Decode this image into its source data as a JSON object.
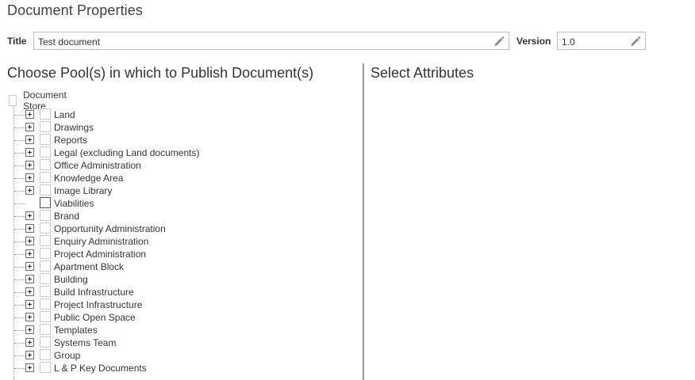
{
  "dialog": {
    "title": "Document Properties"
  },
  "fields": {
    "title_label": "Title",
    "title_value": "Test document",
    "version_label": "Version",
    "version_value": "1.0"
  },
  "pools": {
    "heading": "Choose Pool(s) in which to Publish Document(s)",
    "root_label": "Document Store",
    "items": [
      {
        "label": "Land",
        "expandable": true
      },
      {
        "label": "Drawings",
        "expandable": true
      },
      {
        "label": "Reports",
        "expandable": true
      },
      {
        "label": "Legal (excluding Land documents)",
        "expandable": true
      },
      {
        "label": "Office Administration",
        "expandable": true
      },
      {
        "label": "Knowledge Area",
        "expandable": true
      },
      {
        "label": "Image Library",
        "expandable": true
      },
      {
        "label": "Viabilities",
        "expandable": false
      },
      {
        "label": "Brand",
        "expandable": true
      },
      {
        "label": "Opportunity Administration",
        "expandable": true
      },
      {
        "label": "Enquiry Administration",
        "expandable": true
      },
      {
        "label": "Project Administration",
        "expandable": true
      },
      {
        "label": "Apartment Block",
        "expandable": true
      },
      {
        "label": "Building",
        "expandable": true
      },
      {
        "label": "Build Infrastructure",
        "expandable": true
      },
      {
        "label": "Project Infrastructure",
        "expandable": true
      },
      {
        "label": "Public Open Space",
        "expandable": true
      },
      {
        "label": "Templates",
        "expandable": true
      },
      {
        "label": "Systems Team",
        "expandable": true
      },
      {
        "label": "Group",
        "expandable": true
      },
      {
        "label": "L & P Key Documents",
        "expandable": true
      }
    ]
  },
  "attributes": {
    "heading": "Select Attributes"
  },
  "icons": {
    "edit": "pencil-icon",
    "expand": "plus-box-icon"
  }
}
